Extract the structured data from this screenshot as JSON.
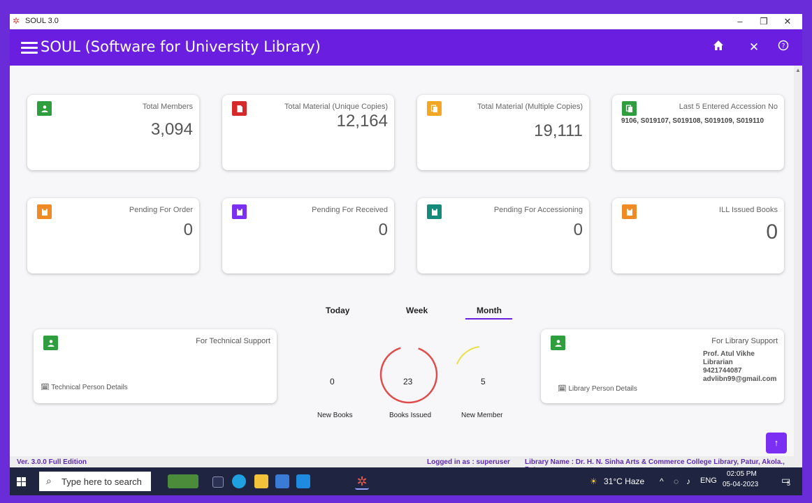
{
  "window": {
    "title": "SOUL 3.0",
    "min": "–",
    "max": "❐",
    "close": "✕"
  },
  "appbar": {
    "title": "SOUL (Software for University Library)",
    "home_icon": "home-icon",
    "close_icon": "close-icon",
    "help_icon": "help-icon"
  },
  "cards_row1": [
    {
      "label": "Total Members",
      "value": "3,094",
      "color": "#2e9e3e"
    },
    {
      "label": "Total Material (Unique Copies)",
      "value": "12,164",
      "color": "#d62a2a"
    },
    {
      "label": "Total Material (Multiple Copies)",
      "value": "19,111",
      "color": "#f5a623"
    },
    {
      "label": "Last 5 Entered Accession No",
      "value": "9106, S019107, S019108, S019109, S019110",
      "color": "#2e9e3e"
    }
  ],
  "cards_row2": [
    {
      "label": "Pending For Order",
      "value": "0",
      "color": "#f08a24"
    },
    {
      "label": "Pending For Received",
      "value": "0",
      "color": "#7b2ff2"
    },
    {
      "label": "Pending For Accessioning",
      "value": "0",
      "color": "#138a7a"
    },
    {
      "label": "ILL Issued Books",
      "value": "0",
      "color": "#f08a24"
    }
  ],
  "tabs": {
    "today": "Today",
    "week": "Week",
    "month": "Month"
  },
  "stats": {
    "new_books": {
      "value": "0",
      "label": "New Books"
    },
    "books_issued": {
      "value": "23",
      "label": "Books Issued"
    },
    "new_member": {
      "value": "5",
      "label": "New Member"
    }
  },
  "tech_support": {
    "title": "For Technical Support",
    "details": "Technical Person Details"
  },
  "library_support": {
    "title": "For Library Support",
    "name": "Prof. Atul Vikhe",
    "role": "Librarian",
    "phone": "9421744087",
    "email": "advlibn99@gmail.com",
    "details": "Library Person Details"
  },
  "status": {
    "version": "Ver. 3.0.0  Full Edition",
    "logged": "Logged in as : superuser",
    "library": "Library Name : Dr. H. N. Sinha Arts & Commerce College Library, Patur, Akola., Patur"
  },
  "taskbar": {
    "search_placeholder": "Type here to search",
    "weather": "31°C  Haze",
    "lang": "ENG",
    "time": "02:05 PM",
    "date": "05-04-2023",
    "notif": "5"
  }
}
